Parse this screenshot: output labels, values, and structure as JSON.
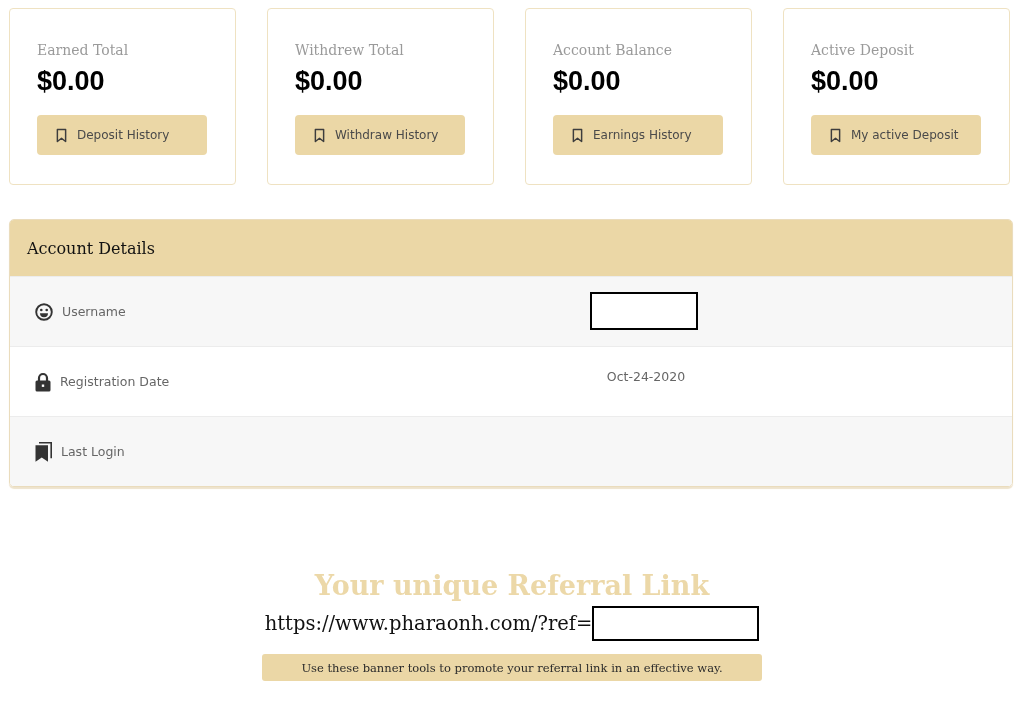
{
  "stat_cards": [
    {
      "label": "Earned Total",
      "amount": "$0.00",
      "button": "Deposit History"
    },
    {
      "label": "Withdrew Total",
      "amount": "$0.00",
      "button": "Withdraw History"
    },
    {
      "label": "Account Balance",
      "amount": "$0.00",
      "button": "Earnings History"
    },
    {
      "label": "Active Deposit",
      "amount": "$0.00",
      "button": "My active Deposit"
    }
  ],
  "account_details": {
    "title": "Account Details",
    "rows": [
      {
        "label": "Username",
        "redacted": true
      },
      {
        "label": "Registration Date",
        "value": "Oct-24-2020",
        "redacted": false
      },
      {
        "label": "Last Login",
        "redacted": false
      }
    ]
  },
  "referral": {
    "title": "Your unique Referral Link",
    "link": "https://www.pharaonh.com/?ref=",
    "redacted": true,
    "note": "Use these banner tools to promote your referral link in an effective way."
  }
}
